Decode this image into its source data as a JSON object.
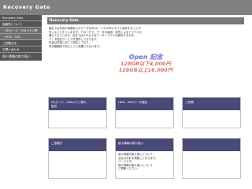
{
  "header": {
    "logo": "Recovery Gate"
  },
  "sidebar": {
    "items": [
      {
        "label": "Recovery Gate"
      },
      {
        "label": "価格表について"
      },
      {
        "label": "・SDカード、USBメモリ等"
      },
      {
        "label": "・HDD、SSD"
      },
      {
        "label": "ご依頼方法"
      },
      {
        "label": "お問い合わせ"
      }
    ],
    "highlight": "個人情報の取り扱い"
  },
  "main": {
    "title": "Recovery Gate",
    "intro": [
      "最近では写真や書類などのデータをSDカードやUSBメモリに保存することが",
      "多くなってきていますが、その一方で、データの破損・消失によるトラブルも",
      "増えてきています。当社ではそのようなデータトラブルを解決するため、",
      "データ復旧サービスを提供しております。",
      "料金は容量に応じて設定しており、",
      "成功報酬制で安心してご依頼いただけます。"
    ],
    "promo": {
      "line1": "Open 記念",
      "line2": "128GB以下4,000円",
      "line3": "128GB以上16,000円"
    }
  },
  "cards": [
    {
      "title": "SDカード、USBメモリ等の",
      "title2": "復旧",
      "body": []
    },
    {
      "title": "HDD、SSDデータ復旧",
      "title2": "",
      "body": []
    },
    {
      "title": "ご質問",
      "title2": "",
      "body": []
    },
    {
      "title": "ご依頼方",
      "title2": "",
      "body": []
    },
    {
      "title": "個人情報の取り扱い",
      "title2": "",
      "body": [
        "個人情報の取り扱いについて、",
        "当社の方針を掲載しております。",
        "ページです。",
        "",
        "個人情報の取り扱いについて",
        "ご理解ください。"
      ]
    },
    {
      "title": "",
      "title2": "",
      "body": []
    }
  ]
}
